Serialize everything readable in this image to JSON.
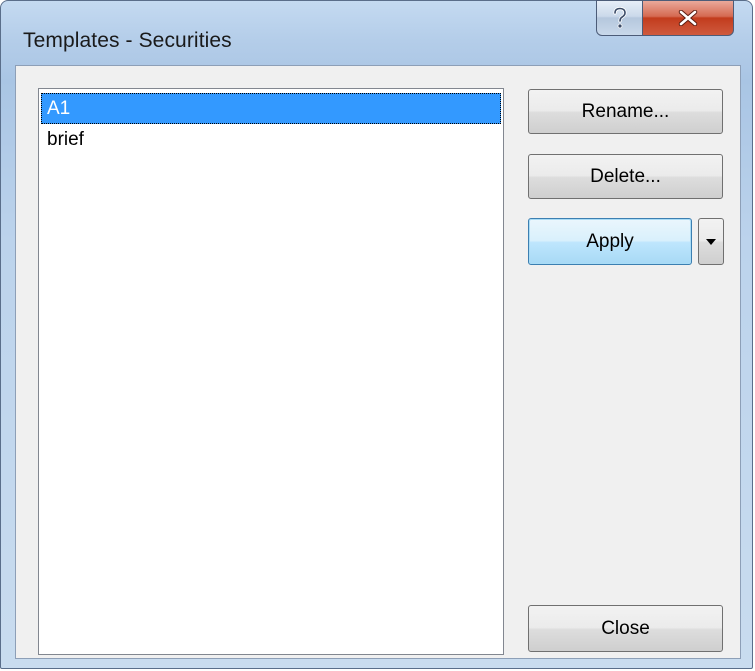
{
  "window": {
    "title": "Templates - Securities",
    "help_icon": "question-mark-icon",
    "close_icon": "close-x-icon"
  },
  "templates": {
    "items": [
      {
        "label": "A1",
        "selected": true
      },
      {
        "label": "brief",
        "selected": false
      }
    ]
  },
  "buttons": {
    "rename": "Rename...",
    "delete": "Delete...",
    "apply": "Apply",
    "apply_dropdown_icon": "caret-down-icon",
    "close": "Close"
  },
  "colors": {
    "selection": "#3399ff",
    "close_button": "#c23c1d",
    "apply_focus": "#3c7fb1"
  }
}
